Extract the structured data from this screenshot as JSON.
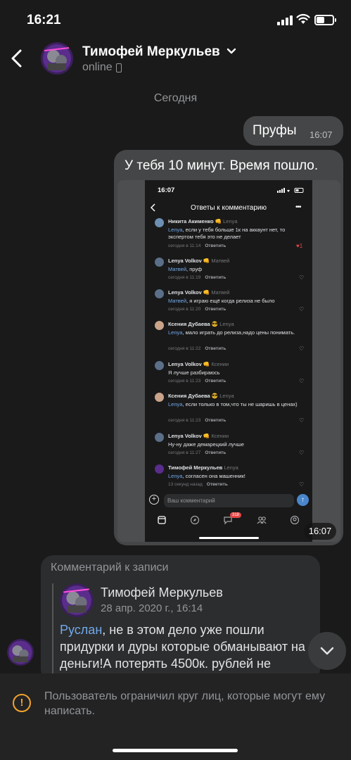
{
  "status_bar": {
    "time": "16:21",
    "battery_level": 0.5
  },
  "header": {
    "name": "Тимофей Меркульев",
    "status": "online",
    "icons": [
      "back-arrow-icon",
      "chevron-down-icon",
      "mobile-icon"
    ]
  },
  "date_separator": "Сегодня",
  "messages": [
    {
      "text": "Пруфы",
      "time": "16:07"
    },
    {
      "text": "У тебя 10 минут. Время пошло.",
      "time": "16:07"
    }
  ],
  "screenshot": {
    "time": "16:07",
    "title": "Ответы к комментарию",
    "input_placeholder": "Ваш комментарий",
    "badge": "318",
    "comments": [
      {
        "name": "Никита Акименко 👊",
        "reply_to": "Lenya",
        "mention": "Lenya",
        "text": ", если у тебя больше 1к на аккаунт нет, то экспертом тебя это не делает",
        "time": "сегодня в 11:14",
        "action": "Ответить",
        "likes": "1"
      },
      {
        "name": "Lenya Volkov 👊",
        "reply_to": "Матвей",
        "mention": "Матвей",
        "text": ", пруф",
        "time": "сегодня в 11:19",
        "action": "Ответить"
      },
      {
        "name": "Lenya Volkov 👊",
        "reply_to": "Матвей",
        "mention": "Матвей",
        "text": ", я играю ещё когда релиза не было",
        "time": "сегодня в 11:20",
        "action": "Ответить"
      },
      {
        "name": "Ксения Дубаева 😎",
        "reply_to": "Lenya",
        "mention": "Lenya",
        "text": ", мало играть до релиза,надо цены понимать.",
        "time": "сегодня в 11:22",
        "action": "Ответить"
      },
      {
        "name": "Lenya Volkov 👊",
        "reply_to": "Ксении",
        "mention": "",
        "text": "Я лучше разбираюсь",
        "time": "сегодня в 11:23",
        "action": "Ответить"
      },
      {
        "name": "Ксения Дубаева 😎",
        "reply_to": "Lenya",
        "mention": "Lenya",
        "text": ", если только в том,что ты не шаришь в ценах)",
        "time": "сегодня в 11:23",
        "action": "Ответить"
      },
      {
        "name": "Lenya Volkov 👊",
        "reply_to": "Ксении",
        "mention": "",
        "text": "Ну-ну даже демарецкий лучше",
        "time": "сегодня в 11:27",
        "action": "Ответить"
      },
      {
        "name": "Тимофей Меркульев",
        "reply_to": "Lenya",
        "mention": "Lenya",
        "text": ", согласен она машенник!",
        "time": "13 секунд назад",
        "action": "Ответить"
      }
    ]
  },
  "incoming": {
    "label": "Комментарий к записи",
    "author": "Тимофей Меркульев",
    "date": "28 апр. 2020 г., 16:14",
    "mention": "Руслан",
    "text": ", не в этом дело уже пошли придурки и дуры которые обманывают на деньги!А потерять 4500к. рублей не"
  },
  "restriction": {
    "text": "Пользователь ограничил круг лиц, которые могут ему написать."
  },
  "colors": {
    "background": "#1a1a1a",
    "bubble_out": "#454647",
    "bubble_in": "#2c2d2e",
    "accent": "#71aaeb",
    "warning": "#f2a32c"
  }
}
